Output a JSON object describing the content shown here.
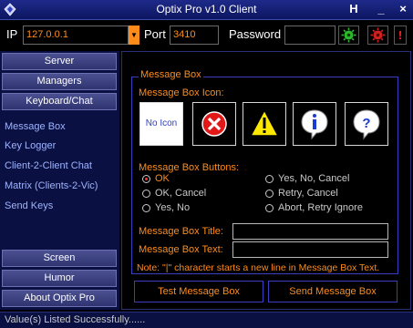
{
  "window": {
    "title": "Optix Pro v1.0 Client",
    "help_label": "H",
    "app_icon": "diamond-icon",
    "minimize_icon": "minimize-icon",
    "close_icon": "close-icon"
  },
  "connection": {
    "ip_label": "IP",
    "ip_value": "127.0.0.1",
    "port_label": "Port",
    "port_value": "3410",
    "password_label": "Password",
    "password_value": "",
    "buttons": [
      "connect-icon",
      "disconnect-icon",
      "alert-icon"
    ],
    "alert_label": "!"
  },
  "sidebar": {
    "top_buttons": [
      "Server",
      "Managers",
      "Keyboard/Chat"
    ],
    "sub_items": [
      "Message Box",
      "Key Logger",
      "Client-2-Client Chat",
      "Matrix (Clients-2-Vic)",
      "Send Keys"
    ],
    "bottom_buttons": [
      "Screen",
      "Humor",
      "About Optix Pro"
    ]
  },
  "message_box": {
    "group_title": "Message Box",
    "icon_label": "Message Box Icon:",
    "icons": [
      {
        "name": "no-icon",
        "label": "No Icon"
      },
      {
        "name": "error-icon"
      },
      {
        "name": "warning-icon"
      },
      {
        "name": "info-icon"
      },
      {
        "name": "question-icon"
      }
    ],
    "buttons_label": "Message Box Buttons:",
    "button_options_left": [
      "OK",
      "OK, Cancel",
      "Yes, No"
    ],
    "button_options_right": [
      "Yes, No, Cancel",
      "Retry, Cancel",
      "Abort, Retry Ignore"
    ],
    "selected_option": "OK",
    "title_label": "Message Box Title:",
    "title_value": "",
    "text_label": "Message Box Text:",
    "text_value": "",
    "note": "Note: \"|\" character starts a new line in Message Box Text."
  },
  "actions": {
    "test_label": "Test Message Box",
    "send_label": "Send Message Box"
  },
  "status": {
    "text": "Value(s) Listed Successfully......"
  },
  "colors": {
    "accent_orange": "#ff8c1a",
    "title_blue": "#1e2a8a",
    "sidebar_navy": "#0a1042",
    "link_blue": "#9fb4ff"
  }
}
